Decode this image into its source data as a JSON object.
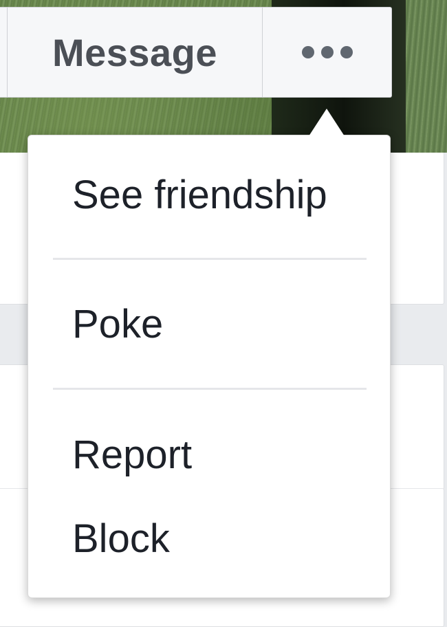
{
  "profile_actions": {
    "message_label": "Message",
    "more_icon": "ellipsis-icon"
  },
  "dropdown": {
    "items": [
      {
        "label": "See friendship"
      },
      {
        "label": "Poke"
      },
      {
        "label": "Report"
      },
      {
        "label": "Block"
      }
    ]
  },
  "colors": {
    "button_bg": "#f6f7f9",
    "button_text": "#4b4f56",
    "menu_text": "#1d2129",
    "separator": "#e5e6e9"
  }
}
